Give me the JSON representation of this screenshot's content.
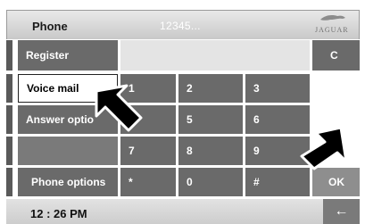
{
  "header": {
    "title": "Phone",
    "number": "12345...",
    "brand": "JAGUAR"
  },
  "menu": {
    "register": "Register",
    "voice_mail": "Voice mail",
    "answer_options": "Answer optio",
    "phone_options": "Phone options"
  },
  "keypad": {
    "k1": "1",
    "k2": "2",
    "k3": "3",
    "k5": "5",
    "k6": "6",
    "k7": "7",
    "k8": "8",
    "k9": "9",
    "star": "*",
    "k0": "0",
    "hash": "#"
  },
  "buttons": {
    "clear": "C",
    "ok": "OK",
    "back": "←"
  },
  "footer": {
    "time": "12 : 26 PM"
  }
}
